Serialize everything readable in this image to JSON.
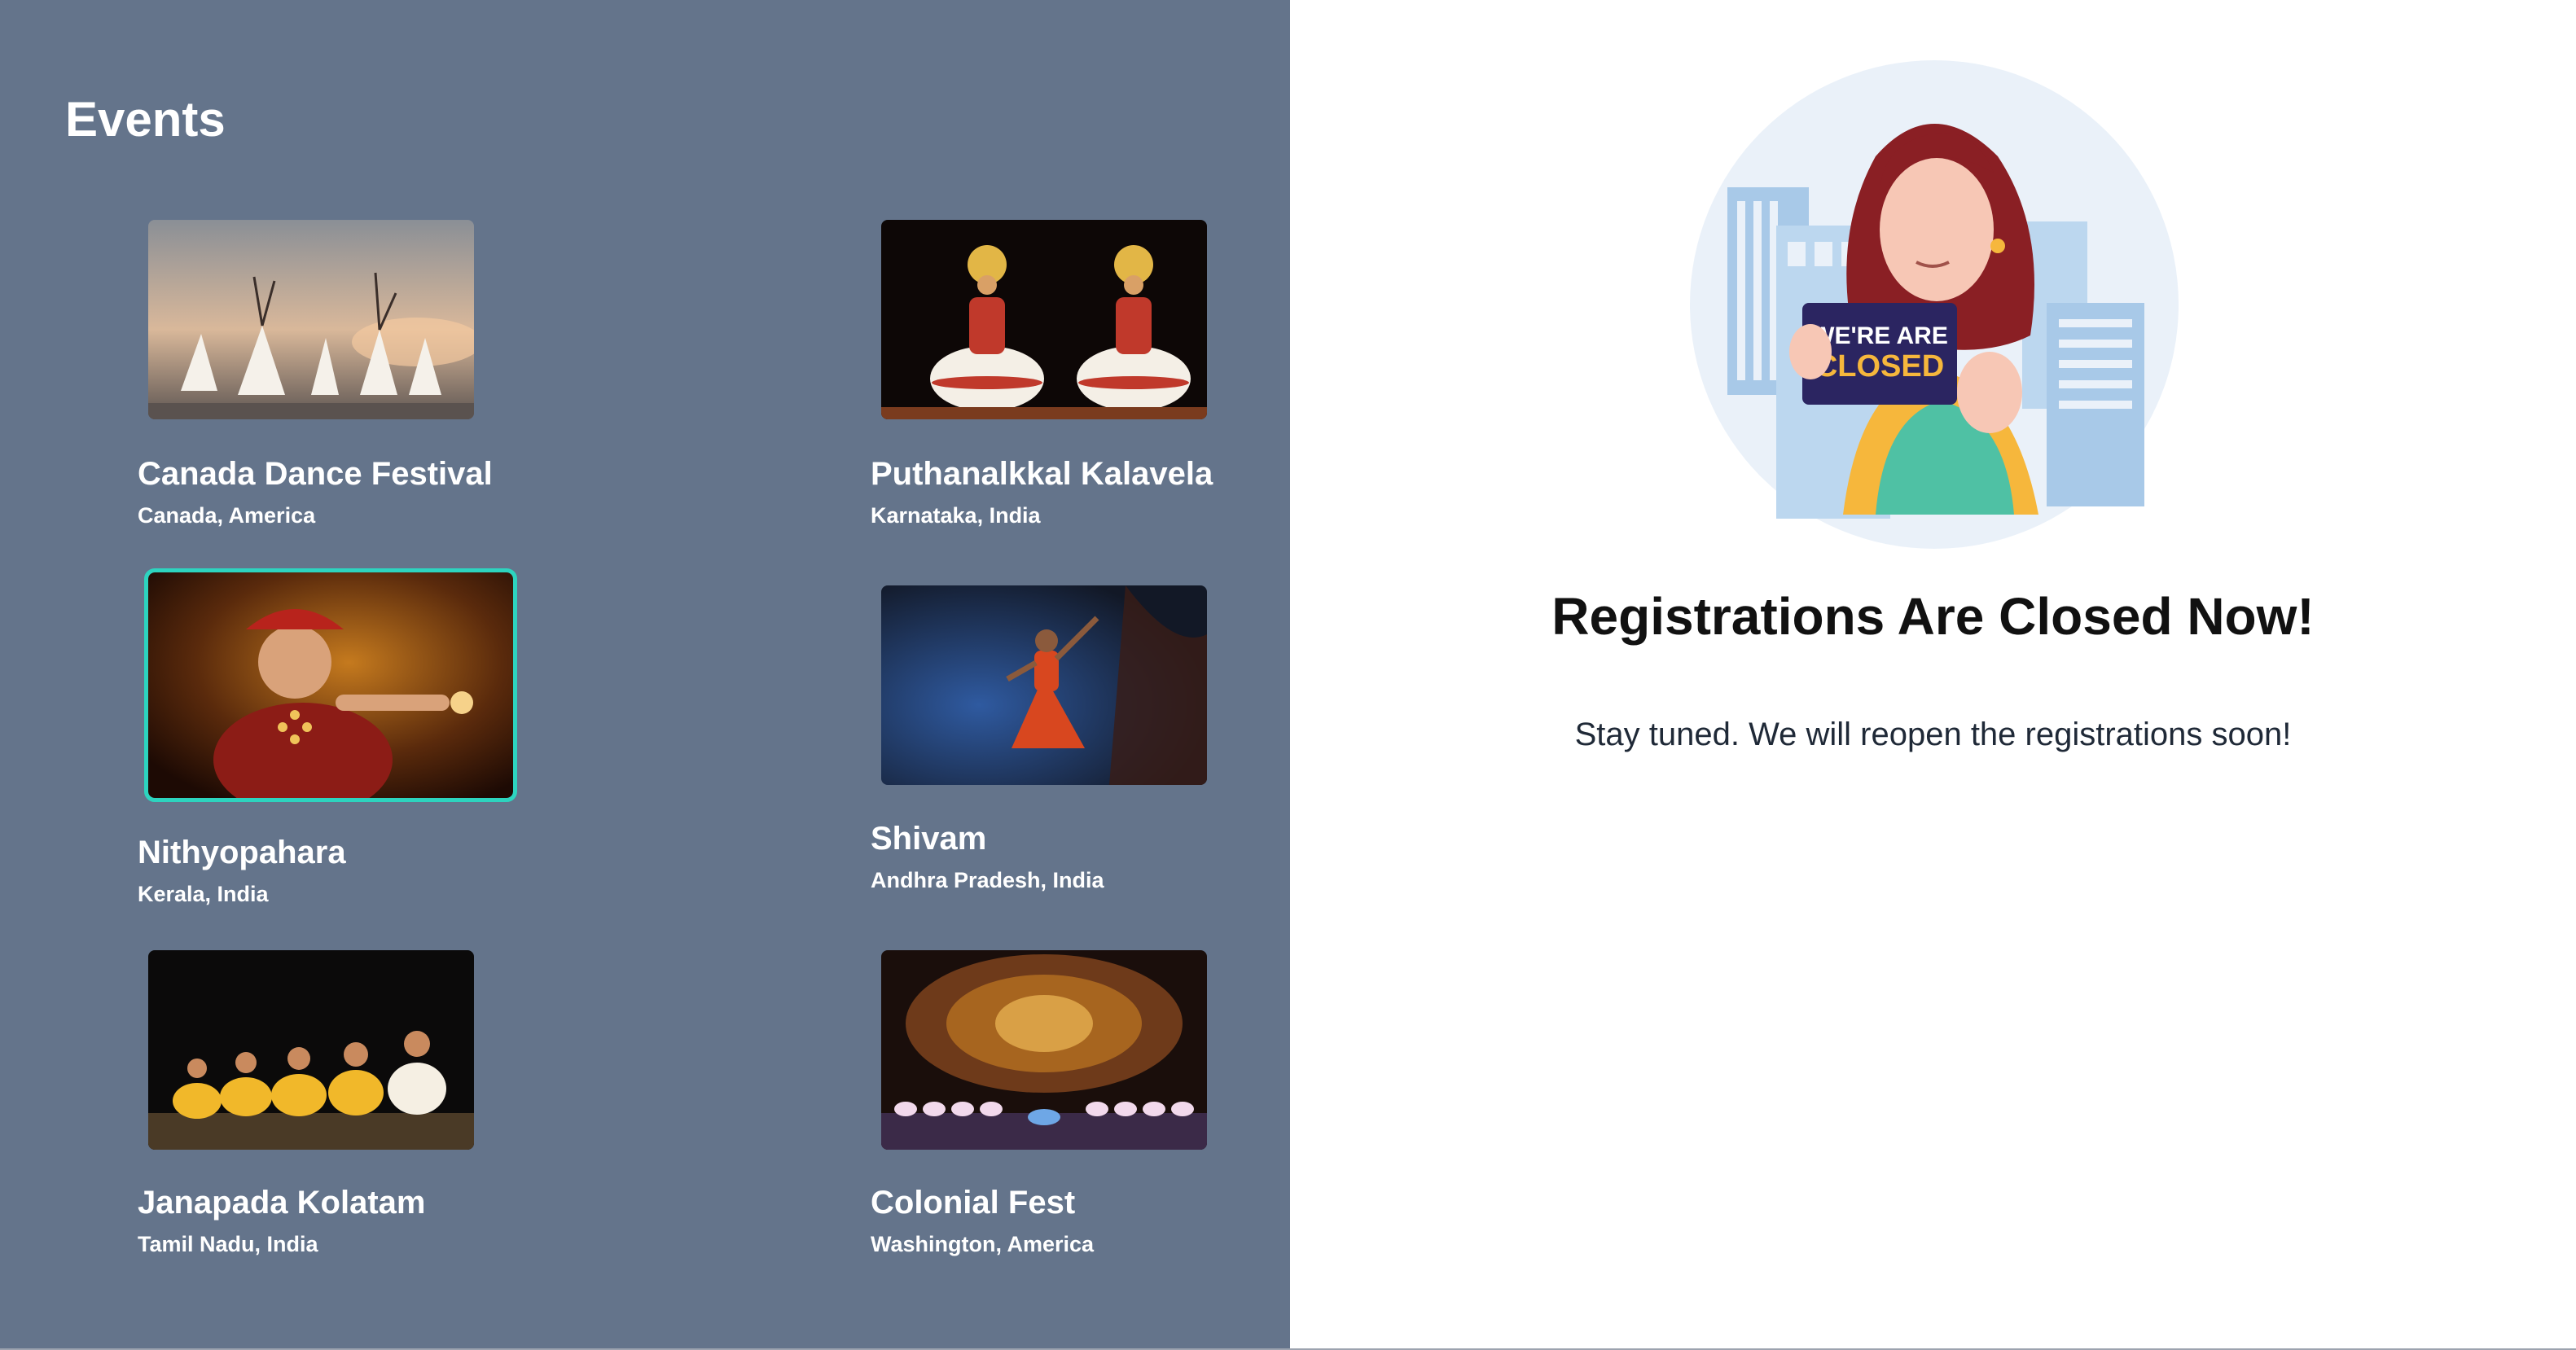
{
  "events": {
    "title": "Events",
    "items": [
      {
        "name": "Canada Dance Festival",
        "location": "Canada, America"
      },
      {
        "name": "Puthanalkkal Kalavela",
        "location": "Karnataka, India"
      },
      {
        "name": "Nithyopahara",
        "location": "Kerala, India",
        "selected": true
      },
      {
        "name": "Shivam",
        "location": "Andhra Pradesh, India"
      },
      {
        "name": "Janapada Kolatam",
        "location": "Tamil Nadu, India"
      },
      {
        "name": "Colonial Fest",
        "location": "Washington, America"
      }
    ]
  },
  "registration": {
    "sign_line1": "WE'RE ARE",
    "sign_line2": "CLOSED",
    "heading": "Registrations Are Closed Now!",
    "subtext": "Stay tuned. We will reopen the registrations soon!"
  },
  "colors": {
    "panel_bg": "#64748b",
    "selected_border": "#2dd4bf"
  }
}
